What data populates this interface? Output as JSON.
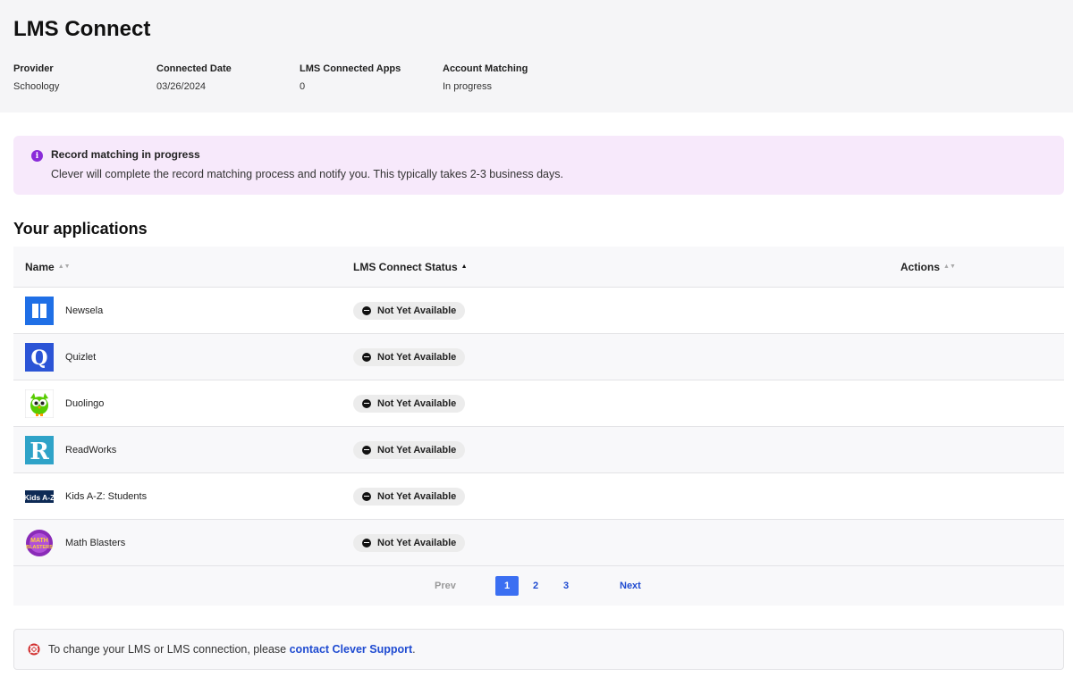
{
  "header": {
    "title": "LMS Connect",
    "meta": [
      {
        "label": "Provider",
        "value": "Schoology"
      },
      {
        "label": "Connected Date",
        "value": "03/26/2024"
      },
      {
        "label": "LMS Connected Apps",
        "value": "0"
      },
      {
        "label": "Account Matching",
        "value": "In progress"
      }
    ]
  },
  "alert": {
    "icon": "info-icon",
    "title": "Record matching in progress",
    "body": "Clever will complete the record matching process and notify you. This typically takes 2-3 business days."
  },
  "applications": {
    "title": "Your applications",
    "columns": [
      "Name",
      "LMS Connect Status",
      "Actions"
    ],
    "rows": [
      {
        "name": "Newsela",
        "status": "Not Yet Available",
        "logo": "newsela-logo"
      },
      {
        "name": "Quizlet",
        "status": "Not Yet Available",
        "logo": "quizlet-logo"
      },
      {
        "name": "Duolingo",
        "status": "Not Yet Available",
        "logo": "duolingo-logo"
      },
      {
        "name": "ReadWorks",
        "status": "Not Yet Available",
        "logo": "readworks-logo"
      },
      {
        "name": "Kids A-Z: Students",
        "status": "Not Yet Available",
        "logo": "kids-az-logo"
      },
      {
        "name": "Math Blasters",
        "status": "Not Yet Available",
        "logo": "math-blasters-logo"
      }
    ],
    "pagination": {
      "prev": "Prev",
      "pages": [
        "1",
        "2",
        "3"
      ],
      "current": "1",
      "next": "Next"
    }
  },
  "logo_text": {
    "quizlet": "Q",
    "readworks": "R",
    "kids_az": "Kids A-Z",
    "math_blasters": "MATH BLASTERS"
  },
  "footer": {
    "text_before": "To change your LMS or LMS connection, please ",
    "link": "contact Clever Support",
    "text_after": "."
  },
  "colors": {
    "accent": "#3b6ff2",
    "link": "#1f4bd1",
    "alert_bg": "#f7e9fb",
    "alert_icon": "#8a2bd9"
  }
}
